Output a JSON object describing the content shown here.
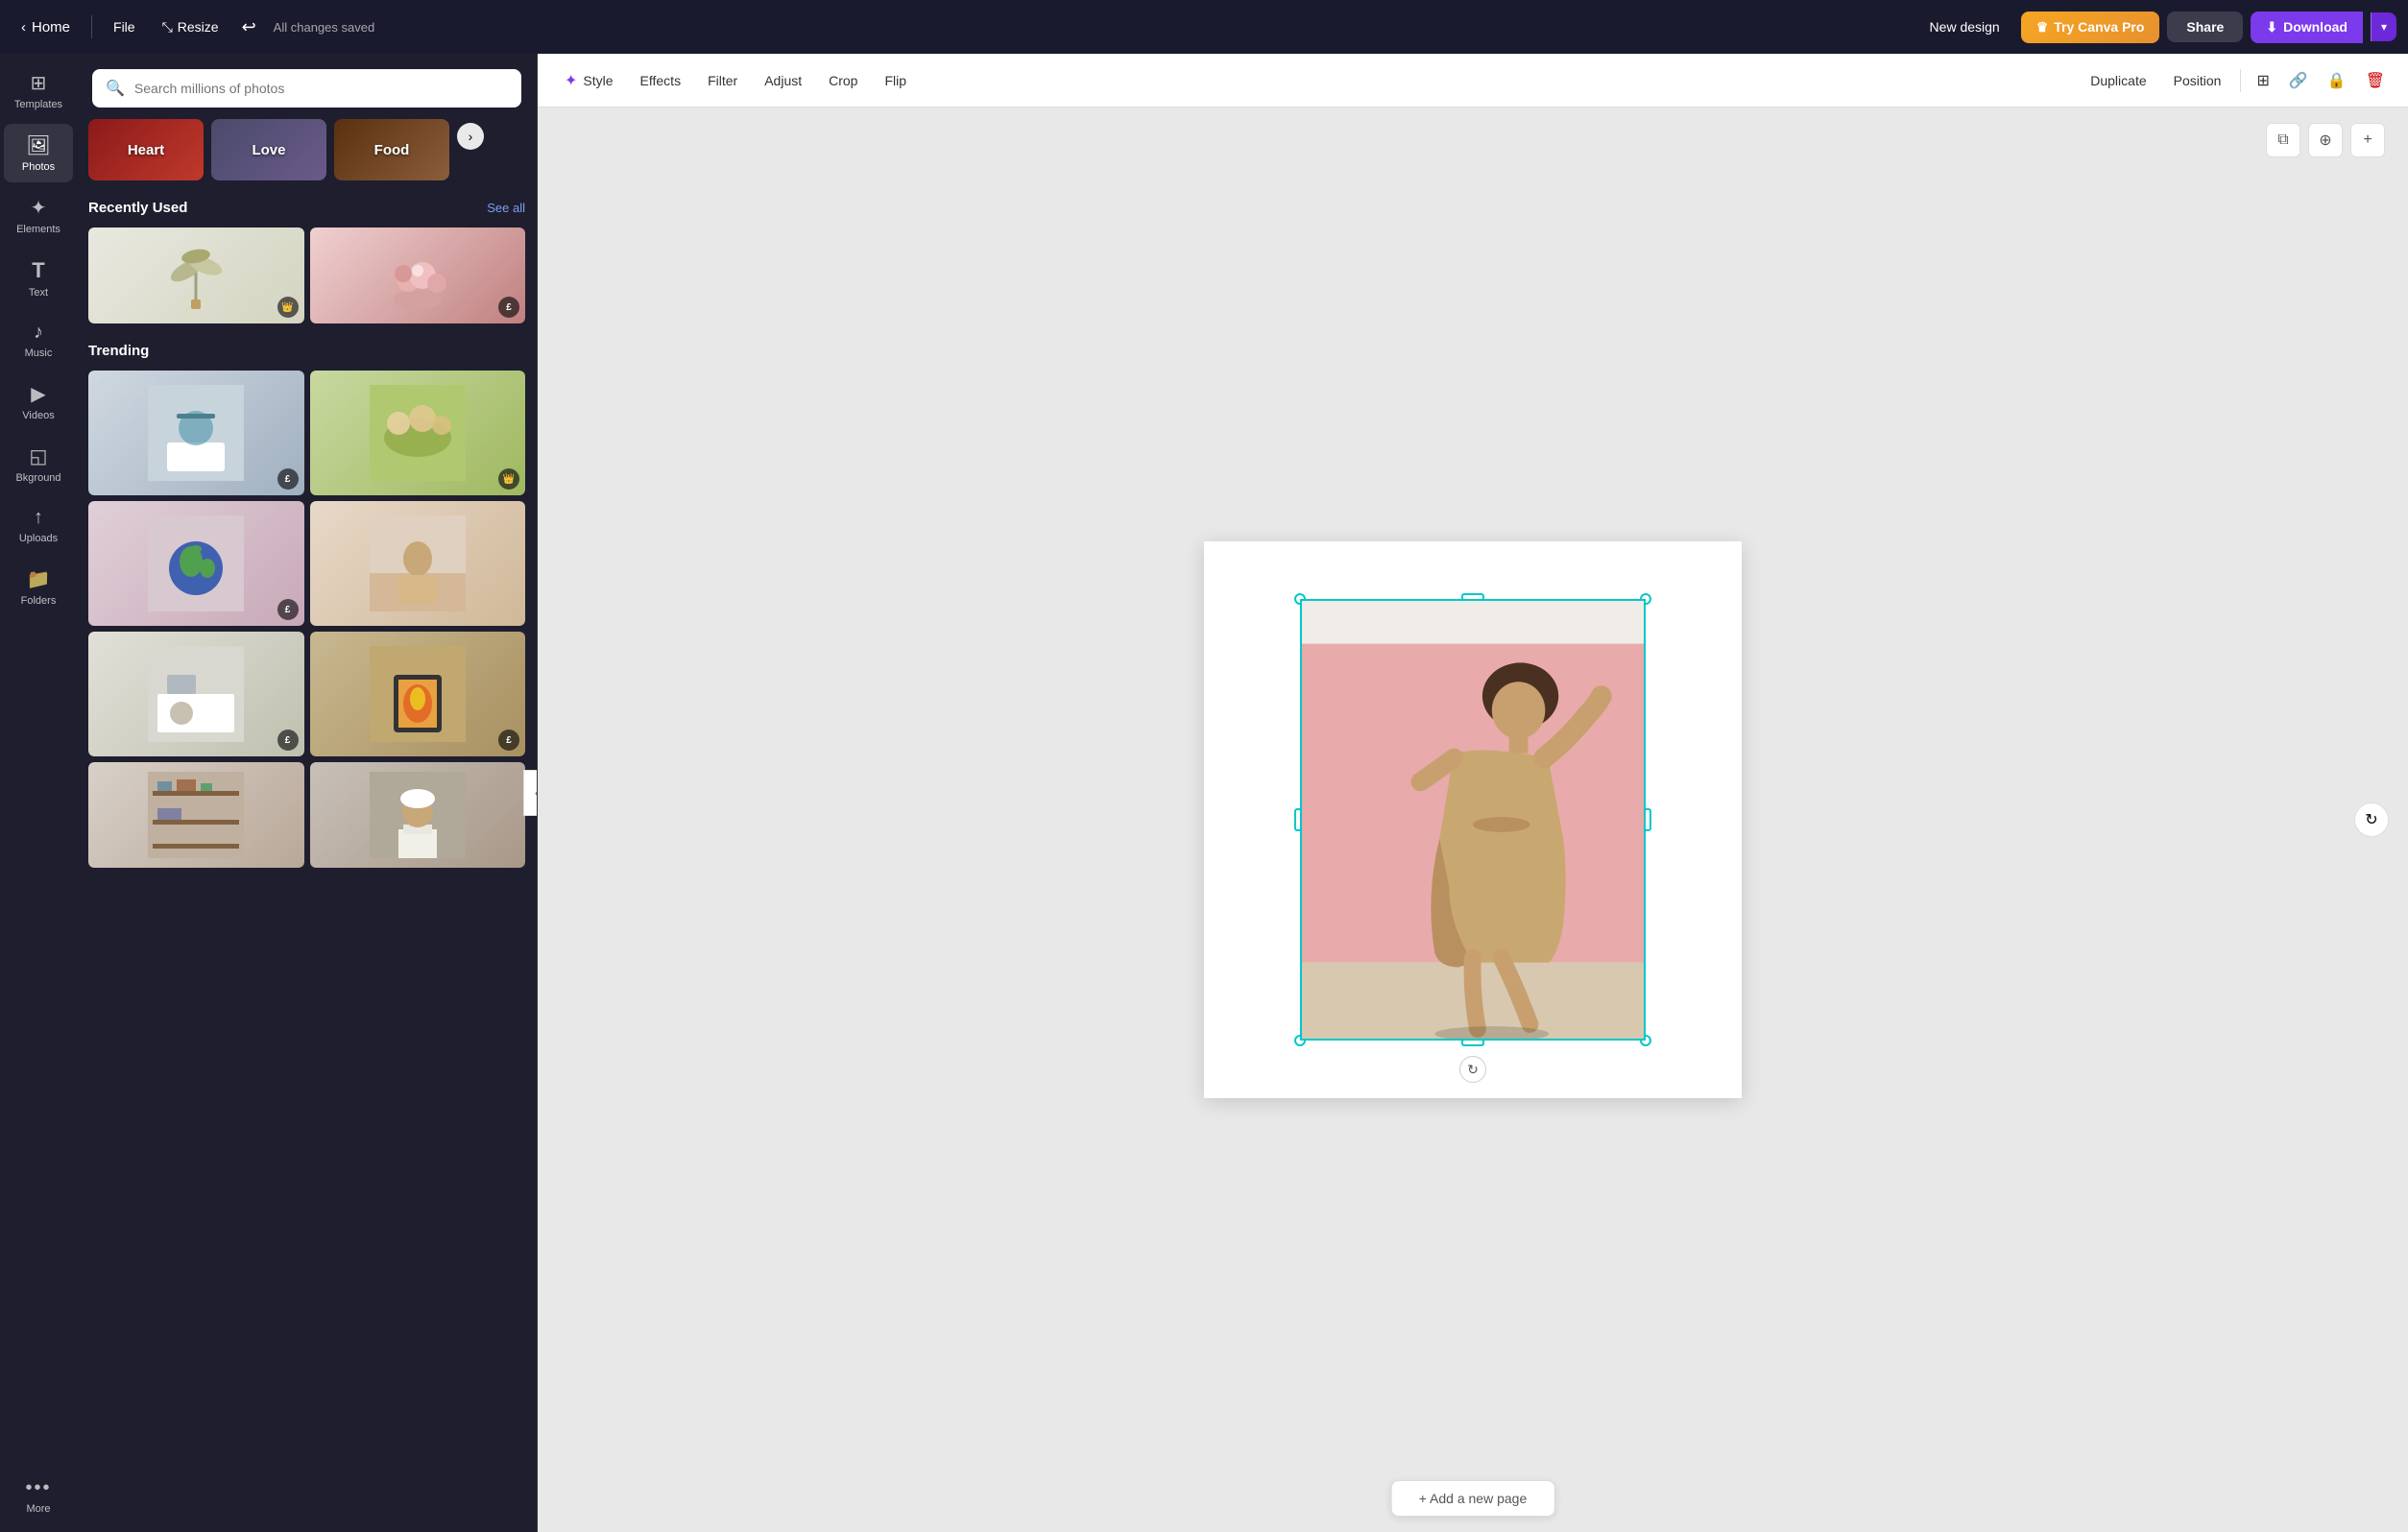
{
  "topNav": {
    "homeLabel": "Home",
    "fileLabel": "File",
    "resizeLabel": "Resize",
    "savedStatus": "All changes saved",
    "newDesignLabel": "New design",
    "tryProLabel": "Try Canva Pro",
    "shareLabel": "Share",
    "downloadLabel": "Download"
  },
  "sidebar": {
    "items": [
      {
        "id": "templates",
        "label": "Templates",
        "icon": "⊞"
      },
      {
        "id": "photos",
        "label": "Photos",
        "icon": "🖼"
      },
      {
        "id": "elements",
        "label": "Elements",
        "icon": "✦"
      },
      {
        "id": "text",
        "label": "Text",
        "icon": "T"
      },
      {
        "id": "music",
        "label": "Music",
        "icon": "♪"
      },
      {
        "id": "videos",
        "label": "Videos",
        "icon": "▶"
      },
      {
        "id": "background",
        "label": "Bkground",
        "icon": "◱"
      },
      {
        "id": "uploads",
        "label": "Uploads",
        "icon": "↑"
      },
      {
        "id": "folders",
        "label": "Folders",
        "icon": "📁"
      },
      {
        "id": "more",
        "label": "More",
        "icon": "•••"
      }
    ]
  },
  "photosPanel": {
    "searchPlaceholder": "Search millions of photos",
    "categories": [
      {
        "id": "heart",
        "label": "Heart"
      },
      {
        "id": "love",
        "label": "Love"
      },
      {
        "id": "food",
        "label": "Food"
      }
    ],
    "recentlyUsed": {
      "title": "Recently Used",
      "seeAllLabel": "See all",
      "photos": [
        {
          "id": "palm",
          "badge": "👑",
          "badgeType": "crown"
        },
        {
          "id": "flowers",
          "badge": "£",
          "badgeType": "pound"
        }
      ]
    },
    "trending": {
      "title": "Trending",
      "photos": [
        {
          "id": "cooking",
          "badge": "£",
          "badgeType": "pound"
        },
        {
          "id": "picnic",
          "badge": "👑",
          "badgeType": "crown"
        },
        {
          "id": "earth",
          "badge": "£",
          "badgeType": "pound"
        },
        {
          "id": "person",
          "badge": null
        },
        {
          "id": "kitchen",
          "badge": "£",
          "badgeType": "pound"
        },
        {
          "id": "fireplace",
          "badge": "£",
          "badgeType": "pound"
        },
        {
          "id": "shelves",
          "badge": null
        },
        {
          "id": "chef",
          "badge": null
        }
      ]
    }
  },
  "toolbar": {
    "styleLabel": "Style",
    "effectsLabel": "Effects",
    "filterLabel": "Filter",
    "adjustLabel": "Adjust",
    "cropLabel": "Crop",
    "flipLabel": "Flip",
    "duplicateLabel": "Duplicate",
    "positionLabel": "Position"
  },
  "canvas": {
    "addPageLabel": "+ Add a new page"
  }
}
